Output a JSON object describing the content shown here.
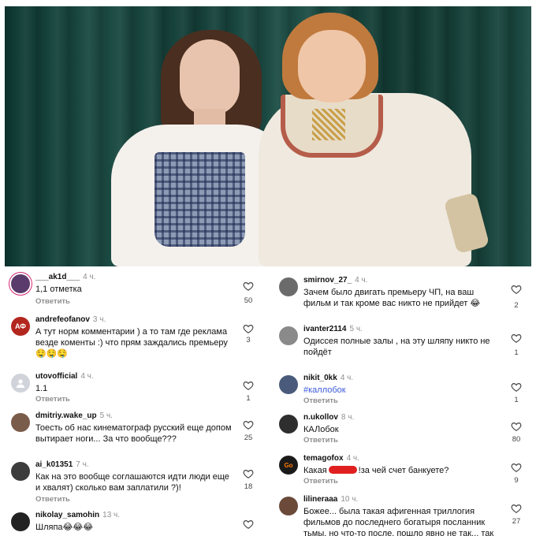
{
  "post": {
    "photo_alt": ""
  },
  "reply_label": "Ответить",
  "left_comments": [
    {
      "user": "___ak1d___",
      "time": "4 ч.",
      "text": "1,1 отметка",
      "likes": "50",
      "avatar_color": "#5a3b6b"
    },
    {
      "user": "andrefeofanov",
      "time": "3 ч.",
      "text": "А тут норм комментарии ) а то там где реклама везде коменты :) что прям заждались премьеру 🤤🤤🤤",
      "likes": "3",
      "avatar_color": "#b3261e",
      "avatar_text": "АФ"
    },
    {
      "user": "utovofficial",
      "time": "4 ч.",
      "text": "1.1",
      "likes": "1",
      "avatar_color": "#c7c7c7"
    },
    {
      "user": "dmitriy.wake_up",
      "time": "5 ч.",
      "text": "Тоесть об нас кинематограф русский еще допом вытирает ноги... За что вообще???",
      "likes": "25",
      "avatar_color": "#7a5c4a"
    },
    {
      "user": "ai_k01351",
      "time": "7 ч.",
      "text": "Как на это вообще соглашаются идти люди еще и хвалят) сколько вам заплатили ?)!",
      "likes": "18",
      "avatar_color": "#3c3c3c"
    },
    {
      "user": "nikolay_samohin",
      "time": "13 ч.",
      "text": "Шляпа😂😂😂",
      "likes": "",
      "avatar_color": "#222222"
    }
  ],
  "right_comments": [
    {
      "user": "smirnov_27_",
      "time": "4 ч.",
      "text": "Зачем было двигать премьеру ЧП, на ваш фильм и так кроме вас никто не прийдет 😂",
      "likes": "2",
      "avatar_color": "#6b6b6b"
    },
    {
      "user": "ivanter2114",
      "time": "5 ч.",
      "text": "Одиссея полные залы , на эту шляпу никто не пойдёт",
      "likes": "1",
      "avatar_color": "#8a8a8a"
    },
    {
      "user": "nikit_0kk",
      "time": "4 ч.",
      "text": "#каллобок",
      "likes": "1",
      "avatar_color": "#4a5a7a"
    },
    {
      "user": "n.ukollov",
      "time": "8 ч.",
      "text": "КАЛобок",
      "likes": "80",
      "avatar_color": "#2e2e2e"
    },
    {
      "user": "temagofox",
      "time": "4 ч.",
      "text_before": "Какая",
      "text_after": "!за чей счет банкуете?",
      "likes": "9",
      "avatar_color": "#1a1a1a",
      "avatar_text": "Go"
    },
    {
      "user": "lilineraaa",
      "time": "10 ч.",
      "text": "Божее... была такая афигенная триллогия фильмов до последнего богатыря посланник тьмы, но что-то после, пошло явно не так... так и",
      "likes": "27",
      "avatar_color": "#6b4a3a"
    }
  ],
  "colors": {
    "likes": "#444444",
    "meta": "#8e8e8e",
    "hashtag": "#3b5bdb",
    "redaction": "#e02020"
  },
  "icons": {
    "like": "heart-outline-icon"
  }
}
